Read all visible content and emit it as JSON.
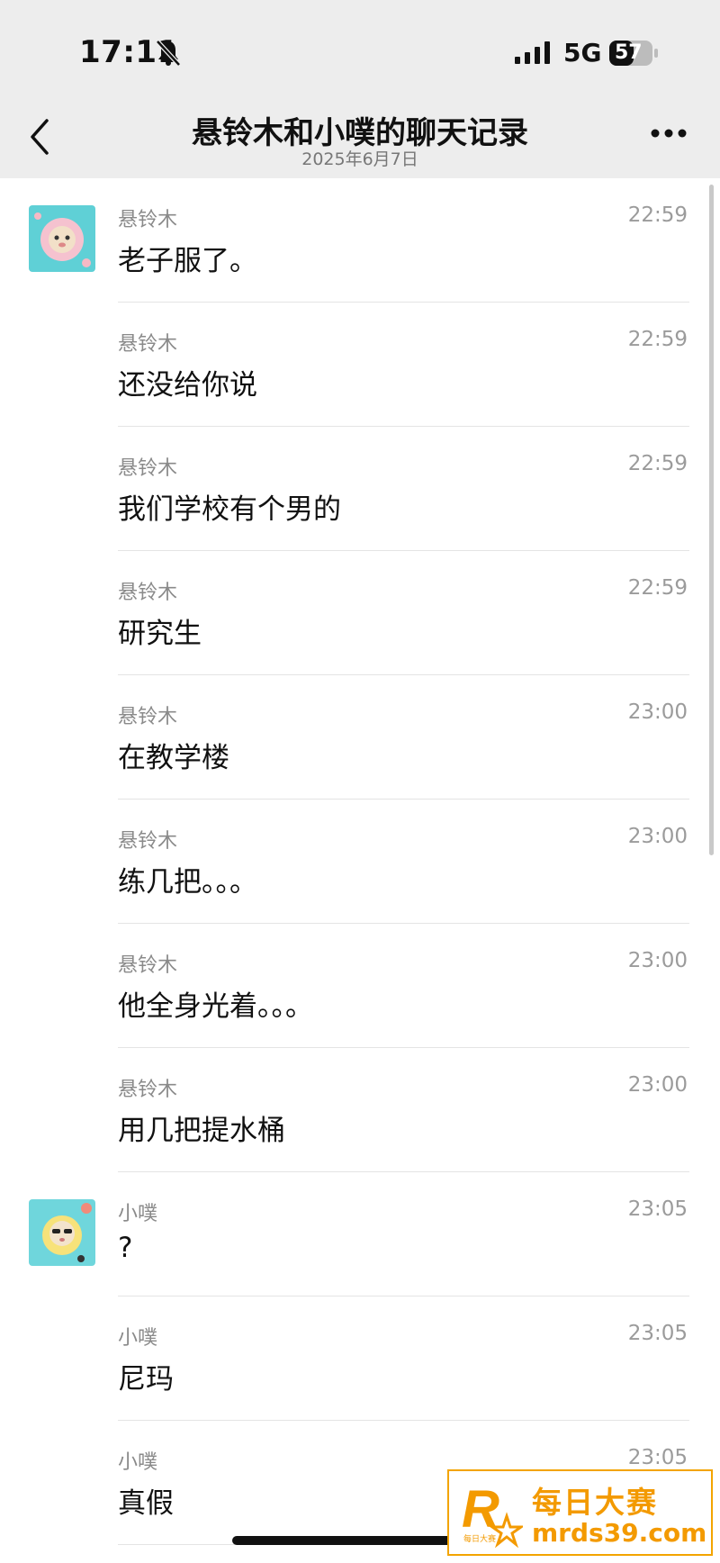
{
  "status_bar": {
    "time": "17:11",
    "network": "5G",
    "battery": "57"
  },
  "header": {
    "title": "悬铃木和小噗的聊天记录",
    "date": "2025年6月7日"
  },
  "messages": [
    {
      "sender": "悬铃木",
      "time": "22:59",
      "text": "老子服了。"
    },
    {
      "sender": "悬铃木",
      "time": "22:59",
      "text": "还没给你说"
    },
    {
      "sender": "悬铃木",
      "time": "22:59",
      "text": "我们学校有个男的"
    },
    {
      "sender": "悬铃木",
      "time": "22:59",
      "text": "研究生"
    },
    {
      "sender": "悬铃木",
      "time": "23:00",
      "text": "在教学楼"
    },
    {
      "sender": "悬铃木",
      "time": "23:00",
      "text": "练几把。。。"
    },
    {
      "sender": "悬铃木",
      "time": "23:00",
      "text": "他全身光着。。。"
    },
    {
      "sender": "悬铃木",
      "time": "23:00",
      "text": "用几把提水桶"
    },
    {
      "sender": "小噗",
      "time": "23:05",
      "text": "?"
    },
    {
      "sender": "小噗",
      "time": "23:05",
      "text": "尼玛"
    },
    {
      "sender": "小噗",
      "time": "23:05",
      "text": "真假"
    }
  ],
  "watermark": {
    "title": "每日大赛",
    "url": "mrds39.com",
    "logo_text": "每日大赛"
  },
  "icons": {
    "mute": "bell-slash-icon",
    "signal": "signal-bars-icon",
    "battery": "battery-icon",
    "back": "chevron-left-icon",
    "more": "more-dots-icon"
  },
  "colors": {
    "header_bg": "#ededed",
    "watermark_accent": "#f39a00"
  }
}
